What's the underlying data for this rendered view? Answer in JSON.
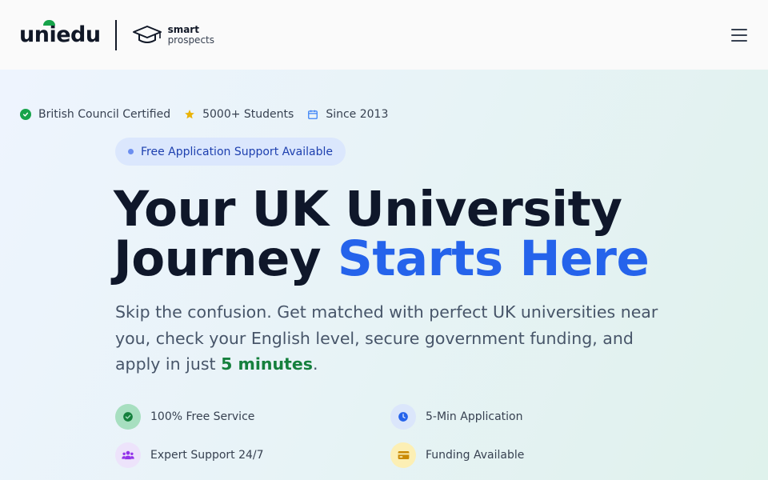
{
  "header": {
    "logo_text": "uniedu",
    "partner_line1": "smart",
    "partner_line2": "prospects",
    "menu_icon": "hamburger-icon"
  },
  "trust_bar": [
    {
      "label": "British Council Certified",
      "icon": "check-circle-icon",
      "color": "#16a34a"
    },
    {
      "label": "5000+ Students",
      "icon": "star-icon",
      "color": "#eab308"
    },
    {
      "label": "Since 2013",
      "icon": "calendar-icon",
      "color": "#3b82f6"
    }
  ],
  "badge": {
    "label": "Free Application Support Available"
  },
  "hero": {
    "title_line1": "Your UK University",
    "title_line2_plain": "Journey ",
    "title_line2_accent": "Starts Here",
    "subtitle_before": "Skip the confusion. Get matched with perfect UK universities near you, check your English level, secure government funding, and apply in just ",
    "subtitle_highlight": "5 minutes",
    "subtitle_after": "."
  },
  "features": [
    {
      "label": "100% Free Service",
      "icon": "check-circle-icon"
    },
    {
      "label": "5-Min Application",
      "icon": "clock-icon"
    },
    {
      "label": "Expert Support 24/7",
      "icon": "users-icon"
    },
    {
      "label": "Funding Available",
      "icon": "wallet-icon"
    }
  ],
  "colors": {
    "accent": "#2563eb",
    "highlight": "#15803d",
    "brand_leaf": "#16a34a"
  }
}
